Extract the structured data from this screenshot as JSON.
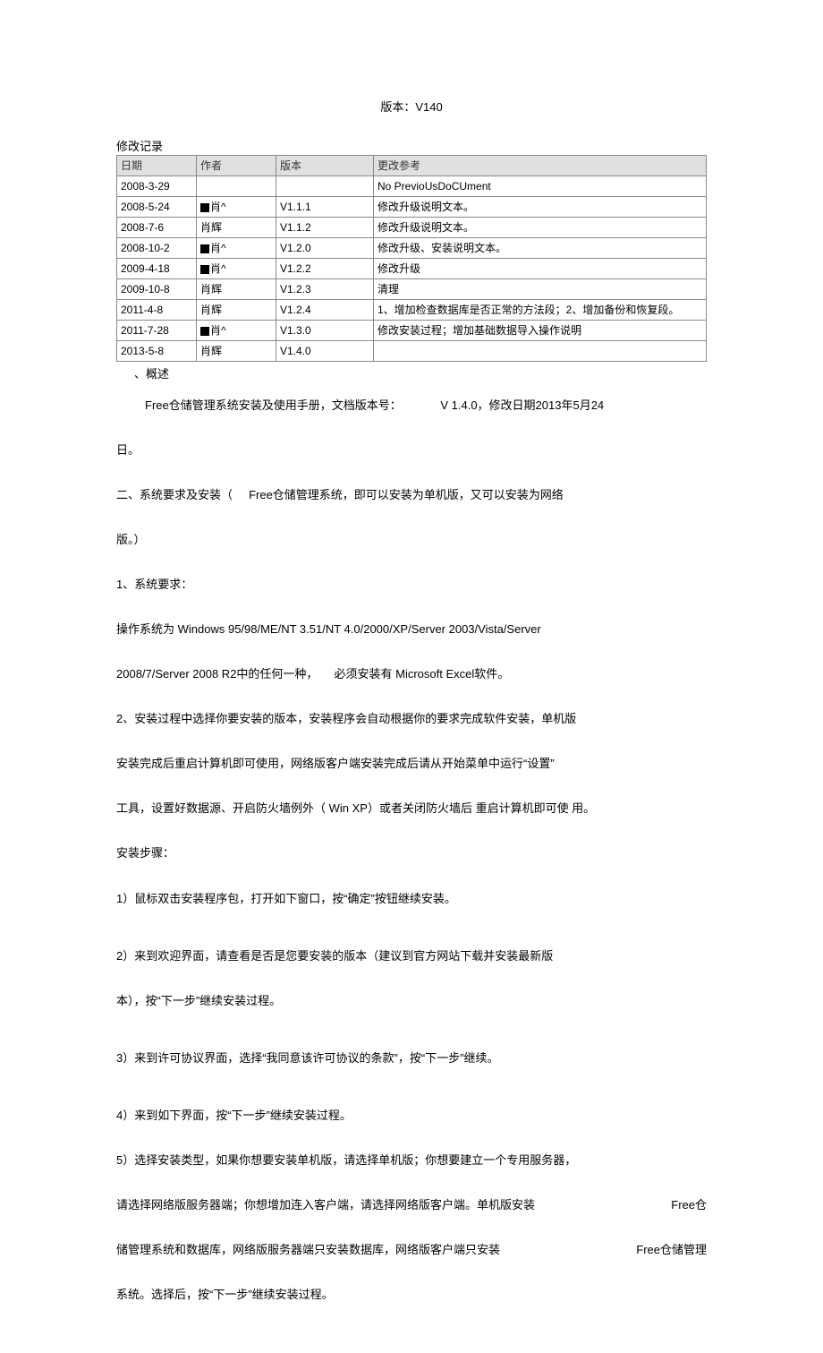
{
  "title": "版本：V140",
  "revision_label": "修改记录",
  "table": {
    "headers": [
      "日期",
      "作者",
      "版本",
      "更改参考"
    ],
    "rows": [
      {
        "date": "2008-3-29",
        "author": "",
        "ver": "",
        "ref": "No PrevioUsDoCUment"
      },
      {
        "date": "2008-5-24",
        "author": "肖^",
        "author_mark": true,
        "ver": "V1.1.1",
        "ref": "修改升级说明文本。"
      },
      {
        "date": "2008-7-6",
        "author": "肖辉",
        "author_mark": false,
        "ver": "V1.1.2",
        "ref": "修改升级说明文本。"
      },
      {
        "date": "2008-10-2",
        "author": "肖^",
        "author_mark": true,
        "ver": "V1.2.0",
        "ref": "修改升级、安装说明文本。"
      },
      {
        "date": "2009-4-18",
        "author": "肖^",
        "author_mark": true,
        "ver": "V1.2.2",
        "ref": "修改升级"
      },
      {
        "date": "2009-10-8",
        "author": "肖辉",
        "author_mark": false,
        "ver": "V1.2.3",
        "ref": "清理"
      },
      {
        "date": "2011-4-8",
        "author": "肖辉",
        "author_mark": false,
        "ver": "V1.2.4",
        "ref": "1、增加检查数据库是否正常的方法段；2、增加备份和恢复段。"
      },
      {
        "date": "2011-7-28",
        "author": "肖^",
        "author_mark": true,
        "ver": "V1.3.0",
        "ref": "修改安装过程；增加基础数据导入操作说明"
      },
      {
        "date": "2013-5-8",
        "author": "肖辉",
        "author_mark": false,
        "ver": "V1.4.0",
        "ref": ""
      }
    ]
  },
  "sec1_heading": "、概述",
  "p1a": "Free仓储管理系统安装及使用手册，文档版本号：",
  "p1b": "V 1.4.0，修改日期2013年5月24",
  "p1c": "日。",
  "p2a": "二、系统要求及安装（",
  "p2b": "Free仓储管理系统，即可以安装为单机版，又可以安装为网络",
  "p2c": "版。）",
  "p3": "1、系统要求：",
  "p4a": "操作系统为  Windows 95/98/ME/NT 3.51/NT 4.0/2000/XP/Server 2003/Vista/Server",
  "p4b": "2008/7/Server 2008 R2中的任何一种，",
  "p4c": "必须安装有  Microsoft Excel软件。",
  "p5": "2、安装过程中选择你要安装的版本，安装程序会自动根据你的要求完成软件安装，单机版",
  "p6": "安装完成后重启计算机即可使用，网络版客户端安装完成后请从开始菜单中运行“设置”",
  "p7": "工具，设置好数据源、开启防火墙例外（  Win XP）或者关闭防火墙后  重启计算机即可使  用。",
  "p8": "安装步骤：",
  "p9": "1）鼠标双击安装程序包，打开如下窗口，按“确定”按钮继续安装。",
  "p10": "2）来到欢迎界面，请查看是否是您要安装的版本（建议到官方网站下载并安装最新版",
  "p11": "本），按“下一步”继续安装过程。",
  "p12": "3）来到许可协议界面，选择“我同意该许可协议的条款”，按“下一步”继续。",
  "p13": "4）来到如下界面，按“下一步”继续安装过程。",
  "p14": "5）选择安装类型，如果你想要安装单机版，请选择单机版；你想要建立一个专用服务器，",
  "p15a": "请选择网络版服务器端；你想增加连入客户端，请选择网络版客户端。单机版安装",
  "p15b": "Free仓",
  "p16a": "储管理系统和数据库，网络版服务器端只安装数据库，网络版客户端只安装",
  "p16b": "Free仓储管理",
  "p17": "系统。选择后，按“下一步”继续安装过程。"
}
